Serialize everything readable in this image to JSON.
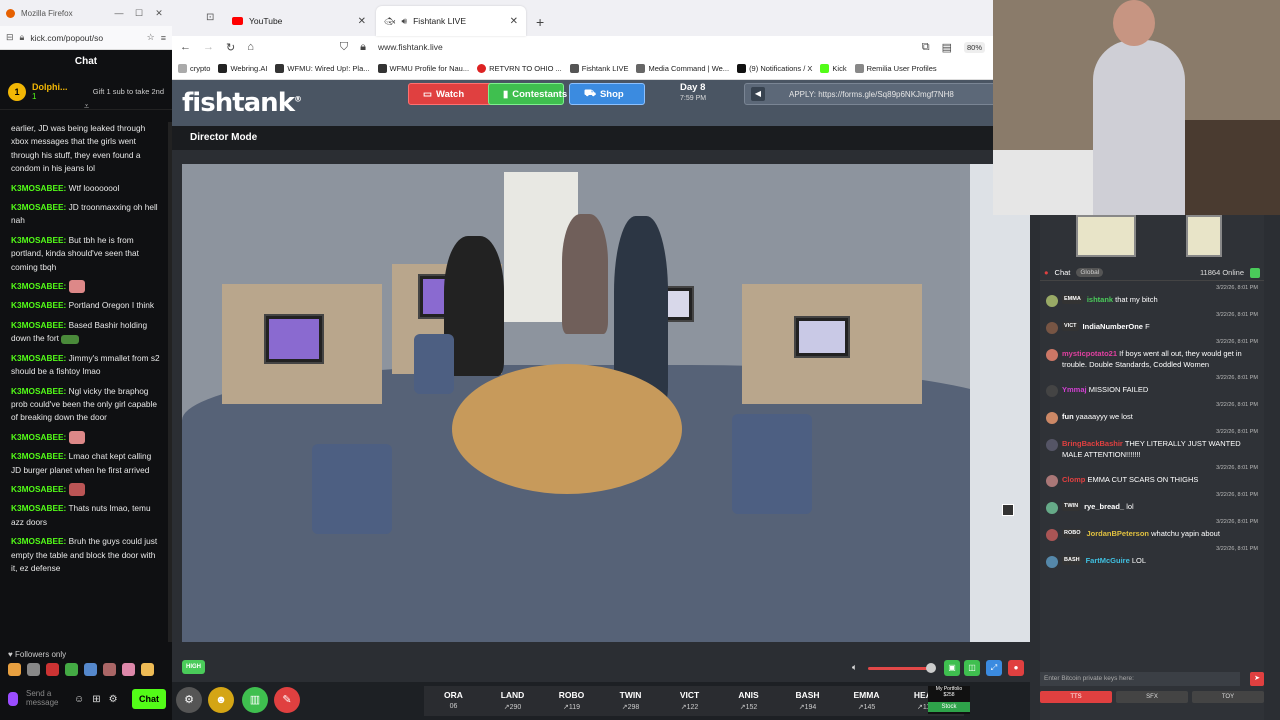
{
  "kick": {
    "window_title": "Mozilla Firefox",
    "url": "kick.com/popout/so",
    "chat_title": "Chat",
    "pinned": {
      "name": "Dolphi...",
      "count": "1",
      "gift_text": "Gift 1 sub to take 2nd"
    },
    "messages": [
      {
        "user": "",
        "text": "earlier, JD was being leaked through xbox messages that the girls went through his stuff, they even found a condom in his jeans lol"
      },
      {
        "user": "K3MOSABEE:",
        "text": "Wtf loooooool"
      },
      {
        "user": "K3MOSABEE:",
        "text": "JD troonmaxxing oh hell nah"
      },
      {
        "user": "K3MOSABEE:",
        "text": "But tbh he is from portland, kinda should've seen that coming tbqh"
      },
      {
        "user": "K3MOSABEE:",
        "text": "",
        "emote": "e1"
      },
      {
        "user": "K3MOSABEE:",
        "text": "Portland Oregon I think"
      },
      {
        "user": "K3MOSABEE:",
        "text": "Based Bashir holding down the fort",
        "emote": "car"
      },
      {
        "user": "K3MOSABEE:",
        "text": "Jimmy's mmallet from s2 should be a fishtoy lmao"
      },
      {
        "user": "K3MOSABEE:",
        "text": "Ngl vicky the braphog prob could've been the only girl capable of breaking down the door"
      },
      {
        "user": "K3MOSABEE:",
        "text": "",
        "emote": "e1"
      },
      {
        "user": "K3MOSABEE:",
        "text": "Lmao chat kept calling JD burger planet when he first arrived"
      },
      {
        "user": "K3MOSABEE:",
        "text": "",
        "emote": "e2"
      },
      {
        "user": "K3MOSABEE:",
        "text": "Thats nuts lmao, temu azz doors"
      },
      {
        "user": "K3MOSABEE:",
        "text": "Bruh the guys could just empty the table and block the door with it, ez defense"
      }
    ],
    "followers_only": "Followers only",
    "input_placeholder": "Send a message",
    "chat_button": "Chat"
  },
  "browser": {
    "tabs": [
      {
        "label": "YouTube"
      },
      {
        "label": "Fishtank LIVE"
      }
    ],
    "url": "www.fishtank.live",
    "zoom": "80%",
    "bookmarks": [
      "crypto",
      "Webring.AI",
      "WFMU: Wired Up!: Pla...",
      "WFMU Profile for Nau...",
      "RETVRN TO OHIO ...",
      "Fishtank LIVE",
      "Media Command | We...",
      "(9) Notifications / X",
      "Kick",
      "Remilia User Profiles"
    ]
  },
  "fishtank": {
    "logo": "fishtank",
    "nav": {
      "watch": "Watch",
      "contestants": "Contestants",
      "shop": "Shop"
    },
    "day": "Day 8",
    "time": "7:59 PM",
    "apply": "APPLY: https://forms.gle/Sq89p6NKJmgf7NH8",
    "director_mode": "Director Mode",
    "quality": "HIGH",
    "stocks": [
      {
        "name": "ORA",
        "value": "06"
      },
      {
        "name": "LAND",
        "value": "↗290"
      },
      {
        "name": "ROBO",
        "value": "↗119"
      },
      {
        "name": "TWIN",
        "value": "↗298"
      },
      {
        "name": "VICT",
        "value": "↗122"
      },
      {
        "name": "ANIS",
        "value": "↗152"
      },
      {
        "name": "BASH",
        "value": "↗194"
      },
      {
        "name": "EMMA",
        "value": "↗145"
      },
      {
        "name": "HEAL",
        "value": "↗117"
      }
    ],
    "portfolio": {
      "label": "My Portfolio",
      "value": "$258",
      "button": "Stock"
    }
  },
  "ftchat": {
    "title": "Chat",
    "scope": "Global",
    "online": "11864 Online",
    "messages": [
      {
        "time": "3/22/26, 8:01 PM",
        "tag": "EMMA",
        "user": "ishtank",
        "user_color": "#4acb5a",
        "text": "that my bitch",
        "av": "#9a6"
      },
      {
        "time": "3/22/26, 8:01 PM",
        "tag": "VICT",
        "user": "IndiaNumberOne",
        "user_color": "#ffffff",
        "text": "F",
        "av": "#754"
      },
      {
        "time": "3/22/26, 8:01 PM",
        "tag": "",
        "user": "mysticpotato21",
        "user_color": "#e040a0",
        "text": "If boys went all out, they would get in trouble. Double Standards, Coddled Women",
        "av": "#c76"
      },
      {
        "time": "3/22/26, 8:01 PM",
        "tag": "",
        "user": "Ymmaj",
        "user_color": "#d040d0",
        "text": "MISSION FAILED",
        "av": "#444"
      },
      {
        "time": "3/22/26, 8:01 PM",
        "tag": "",
        "user": "fun",
        "user_color": "#ffffff",
        "text": "yaaaayyy we lost",
        "av": "#c86"
      },
      {
        "time": "3/22/26, 8:01 PM",
        "tag": "",
        "user": "BringBackBashir",
        "user_color": "#e04040",
        "text": "THEY LITERALLY JUST WANTED MALE ATTENTION!!!!!!!",
        "av": "#556"
      },
      {
        "time": "3/22/26, 8:01 PM",
        "tag": "",
        "user": "Clomp",
        "user_color": "#e04040",
        "text": "EMMA CUT SCARS ON THIGHS",
        "av": "#a77"
      },
      {
        "time": "3/22/26, 8:01 PM",
        "tag": "TWIN",
        "user": "rye_bread_",
        "user_color": "#ffffff",
        "text": "lol",
        "av": "#6a8"
      },
      {
        "time": "3/22/26, 8:01 PM",
        "tag": "ROBO",
        "user": "JordanBPeterson",
        "user_color": "#e0c040",
        "text": "whatchu yapin about",
        "av": "#a55"
      },
      {
        "time": "3/22/26, 8:01 PM",
        "tag": "BASH",
        "user": "FartMcGuire",
        "user_color": "#40c0e0",
        "text": "LOL",
        "av": "#58a"
      }
    ],
    "input_placeholder": "Enter Bitcoin private keys here:",
    "modes": [
      "TTS",
      "SFX",
      "TOY"
    ]
  }
}
